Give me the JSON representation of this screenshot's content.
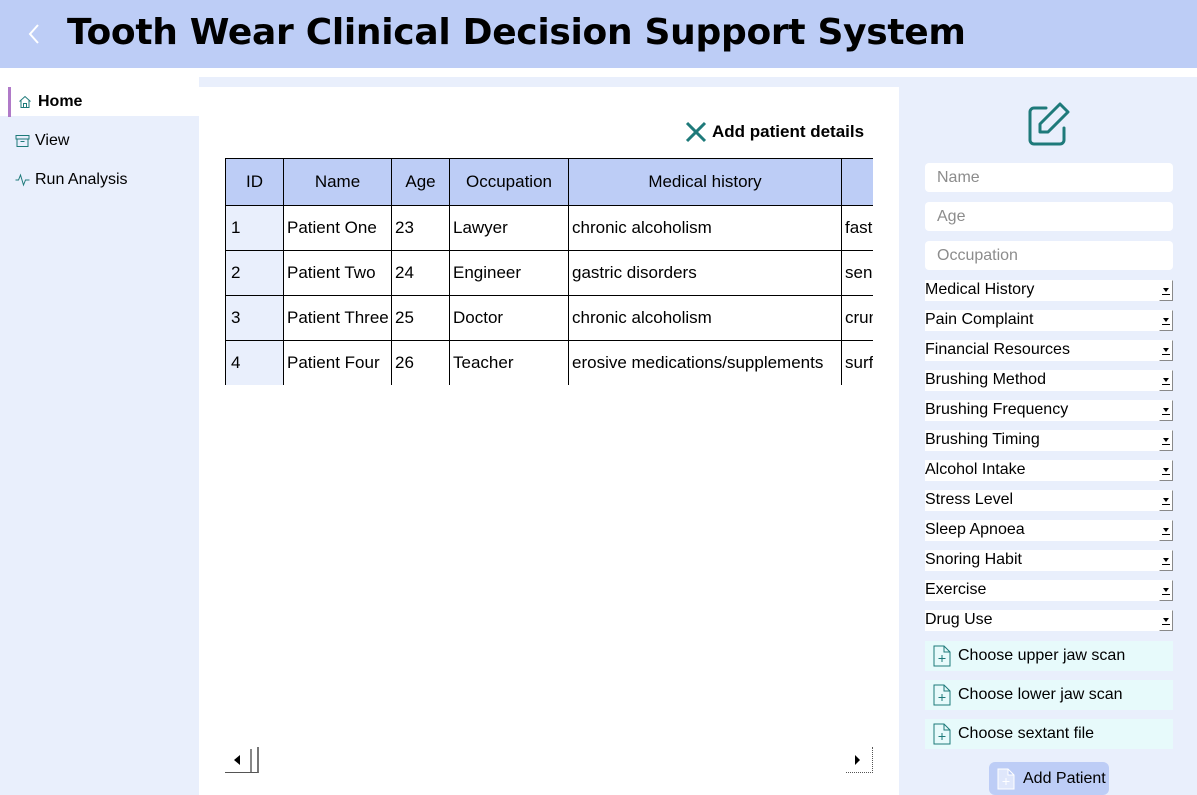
{
  "header": {
    "title": "Tooth Wear Clinical Decision Support System",
    "back_icon": "chevron-left-icon"
  },
  "sidebar": {
    "items": [
      {
        "label": "Home",
        "icon": "home-icon",
        "active": true
      },
      {
        "label": "View",
        "icon": "archive-icon",
        "active": false
      },
      {
        "label": "Run Analysis",
        "icon": "activity-icon",
        "active": false
      }
    ]
  },
  "main": {
    "add_details_label": "Add patient details",
    "table": {
      "columns": [
        "ID",
        "Name",
        "Age",
        "Occupation",
        "Medical history",
        ""
      ],
      "rows": [
        [
          "1",
          "Patient One",
          "23",
          "Lawyer",
          "chronic alcoholism",
          "fast"
        ],
        [
          "2",
          "Patient Two",
          "24",
          "Engineer",
          "gastric disorders",
          "sens"
        ],
        [
          "3",
          "Patient Three",
          "25",
          "Doctor",
          "chronic alcoholism",
          "crun"
        ],
        [
          "4",
          "Patient Four",
          "26",
          "Teacher",
          "erosive medications/supplements",
          "surf"
        ]
      ]
    }
  },
  "form": {
    "name_placeholder": "Name",
    "age_placeholder": "Age",
    "occupation_placeholder": "Occupation",
    "selects": [
      "Medical History",
      "Pain Complaint",
      "Financial Resources",
      "Brushing Method",
      "Brushing Frequency",
      "Brushing Timing",
      "Alcohol Intake",
      "Stress Level",
      "Sleep Apnoea",
      "Snoring Habit",
      "Exercise",
      "Drug Use"
    ],
    "file_buttons": [
      "Choose upper jaw scan",
      "Choose lower jaw scan",
      "Choose sextant file"
    ],
    "submit_label": "Add Patient"
  },
  "colors": {
    "header_bg": "#bdcdf6",
    "panel_bg": "#e9effc",
    "accent_teal": "#1e7a7a",
    "active_marker": "#b07ac8",
    "file_btn_bg": "#e7fafb"
  }
}
